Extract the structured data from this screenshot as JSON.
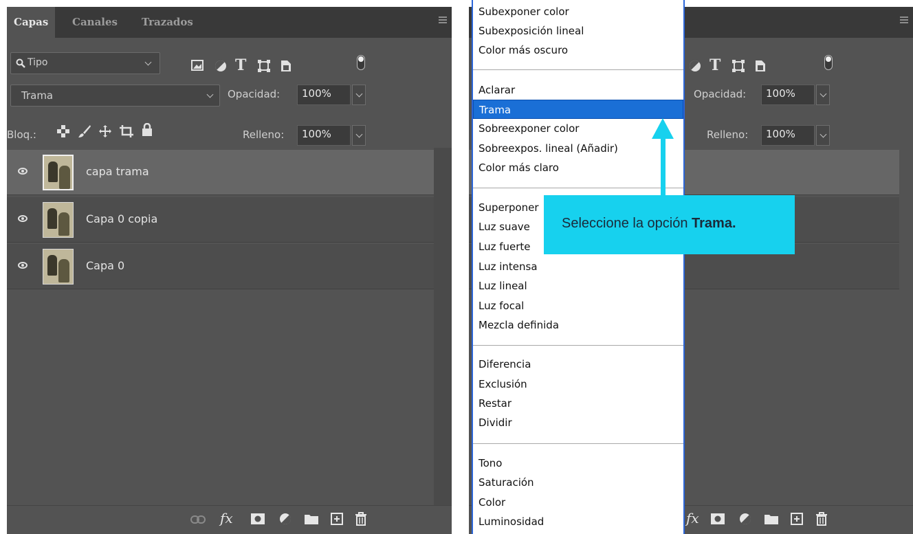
{
  "left_panel": {
    "tabs": [
      "Capas",
      "Canales",
      "Trazados"
    ],
    "filter": {
      "kind_label": "Tipo"
    },
    "blend_mode": "Trama",
    "opacity_label": "Opacidad:",
    "opacity_value": "100%",
    "lock_label": "Bloq.:",
    "fill_label": "Relleno:",
    "fill_value": "100%",
    "layers": [
      {
        "name": "capa trama",
        "selected": true
      },
      {
        "name": "Capa 0 copia",
        "selected": false
      },
      {
        "name": "Capa 0",
        "selected": false
      }
    ],
    "bottom_icons": [
      "link-icon",
      "fx-icon",
      "mask-icon",
      "adjustment-icon",
      "folder-icon",
      "new-layer-icon",
      "trash-icon"
    ]
  },
  "right_panel": {
    "opacity_label": "Opacidad:",
    "opacity_value": "100%",
    "fill_label": "Relleno:",
    "fill_value": "100%"
  },
  "blend_menu": {
    "groups": [
      [
        "Subexponer color",
        "Subexposición lineal",
        "Color más oscuro"
      ],
      [
        "Aclarar",
        "Trama",
        "Sobreexponer color",
        "Sobreexpos. lineal (Añadir)",
        "Color más claro"
      ],
      [
        "Superponer",
        "Luz suave",
        "Luz fuerte",
        "Luz intensa",
        "Luz lineal",
        "Luz focal",
        "Mezcla definida"
      ],
      [
        "Diferencia",
        "Exclusión",
        "Restar",
        "Dividir"
      ],
      [
        "Tono",
        "Saturación",
        "Color",
        "Luminosidad"
      ]
    ],
    "highlighted": "Trama"
  },
  "callout": {
    "prefix": "Seleccione la opción ",
    "bold": "Trama."
  },
  "colors": {
    "panel_bg": "#535353",
    "highlight": "#1a6fd6",
    "callout": "#17d1ee"
  }
}
